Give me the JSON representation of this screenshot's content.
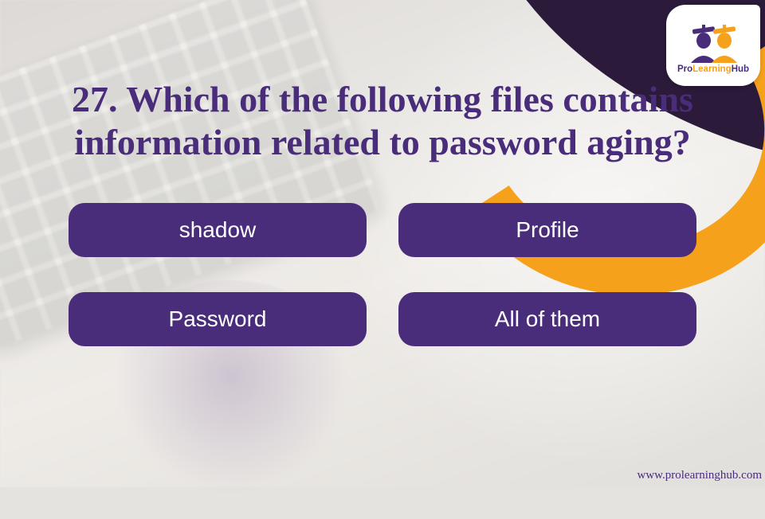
{
  "brand": {
    "name_prefix": "Pro",
    "name_mid": "Learning",
    "name_suffix": "Hub"
  },
  "question": "27. Which of the following files contains information related to password aging?",
  "options": {
    "a": "shadow",
    "b": "Profile",
    "c": "Password",
    "d": "All of them"
  },
  "footer_url": "www.prolearninghub.com"
}
